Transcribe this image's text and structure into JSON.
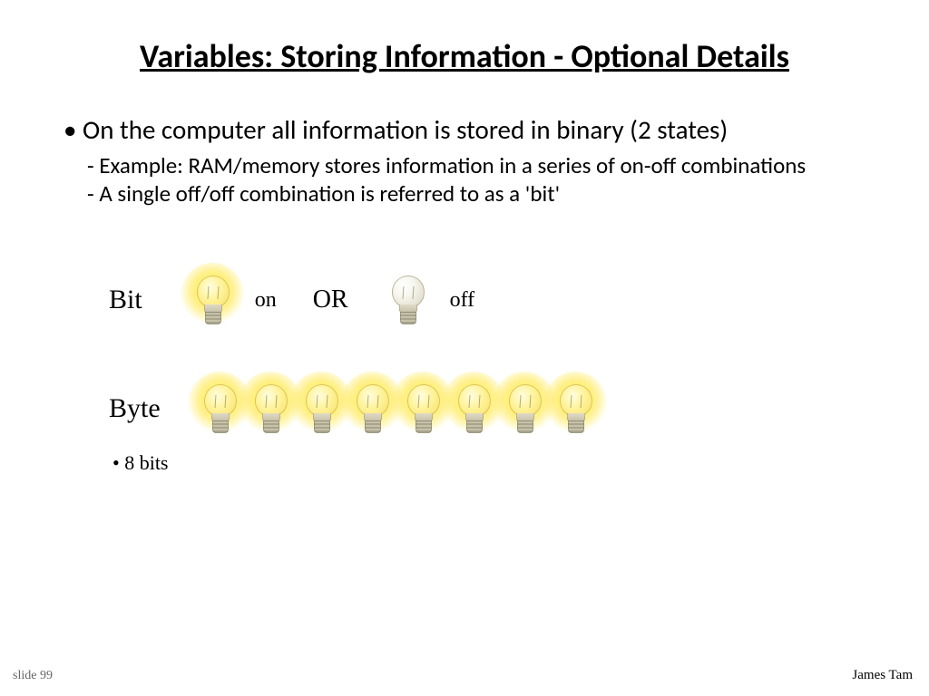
{
  "title": "Variables: Storing Information - Optional Details",
  "main_bullet": "On the computer all information is stored in binary (2 states)",
  "sub_bullets": [
    "Example: RAM/memory stores information in a series of on-off combinations",
    "A single off/off combination is referred to as a 'bit'"
  ],
  "bit": {
    "label": "Bit",
    "on_text": "on",
    "or_text": "OR",
    "off_text": "off"
  },
  "byte": {
    "label": "Byte",
    "sub": "• 8 bits",
    "count": 8
  },
  "footer": {
    "slide": "slide 99",
    "author": "James Tam"
  }
}
